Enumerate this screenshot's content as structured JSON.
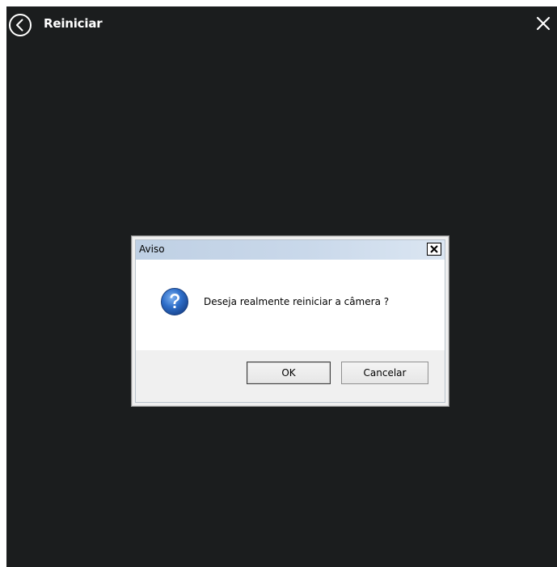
{
  "header": {
    "title": "Reiniciar",
    "back_icon": "back-circle-icon",
    "close_icon": "close-icon"
  },
  "dialog": {
    "title": "Aviso",
    "message": "Deseja realmente reiniciar a câmera ?",
    "icon": "question-icon",
    "close_icon": "close-icon",
    "ok_label": "OK",
    "cancel_label": "Cancelar"
  },
  "colors": {
    "app_background": "#1b1d1e",
    "header_text": "#ffffff",
    "dialog_titlebar": "#c9d8ea",
    "dialog_body": "#ffffff",
    "dialog_footer": "#f0f0f0",
    "question_icon": "#2e6ec9"
  }
}
